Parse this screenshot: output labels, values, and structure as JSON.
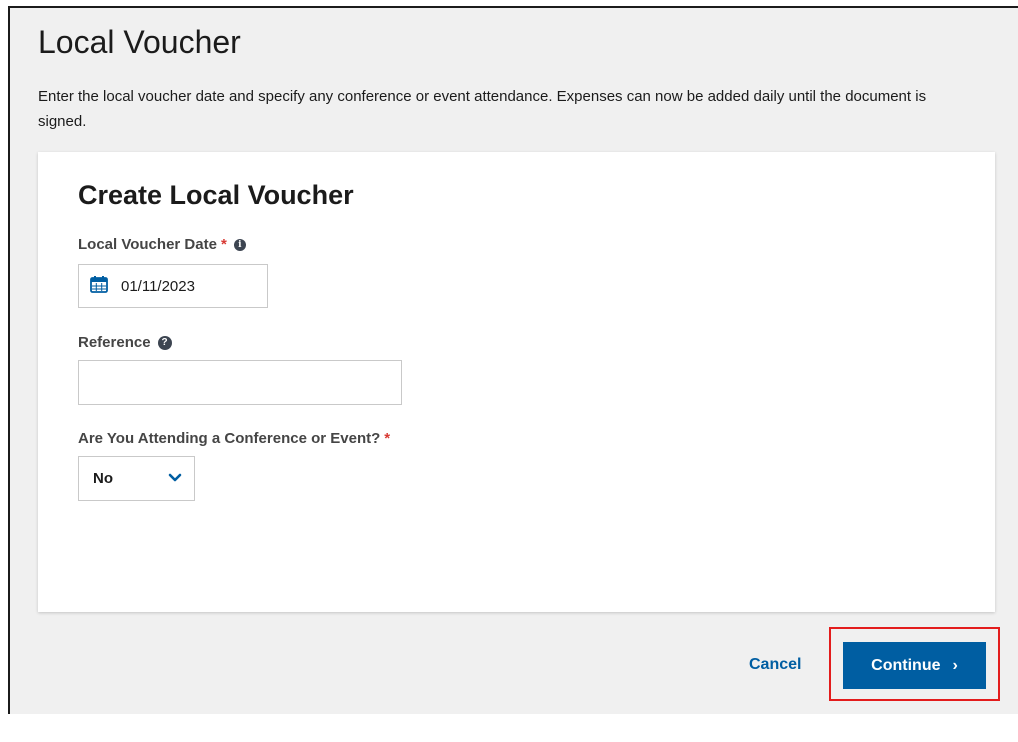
{
  "page": {
    "title": "Local Voucher",
    "description": "Enter the local voucher date and specify any conference or event attendance. Expenses can now be added daily until the document is signed."
  },
  "form": {
    "title": "Create Local Voucher",
    "date_label": "Local Voucher Date",
    "date_value": "01/11/2023",
    "reference_label": "Reference",
    "reference_value": "",
    "conference_label": "Are You Attending a Conference or Event?",
    "conference_value": "No",
    "required_mark": "*"
  },
  "actions": {
    "cancel_label": "Cancel",
    "continue_label": "Continue",
    "continue_chevron": "›"
  },
  "colors": {
    "primary": "#005ea2",
    "required": "#d83933",
    "highlight": "#e31c1c",
    "background": "#f0f0f0"
  },
  "icons": [
    "calendar-icon",
    "info-icon",
    "help-icon",
    "chevron-down-icon",
    "chevron-right-icon"
  ]
}
